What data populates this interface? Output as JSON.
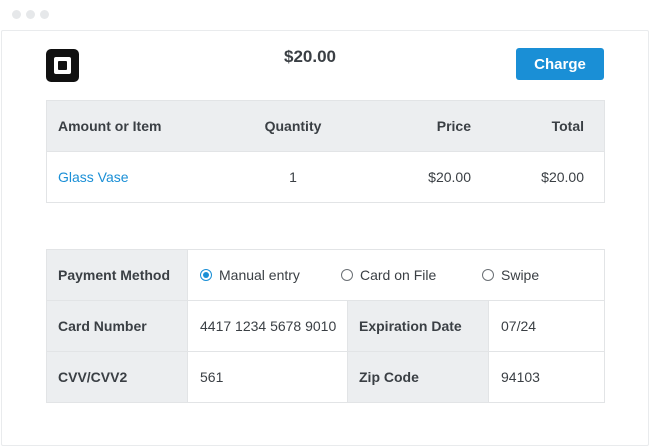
{
  "header": {
    "total": "$20.00",
    "charge_label": "Charge",
    "logo_icon": "square-logo-icon"
  },
  "items_table": {
    "columns": [
      "Amount or Item",
      "Quantity",
      "Price",
      "Total"
    ],
    "rows": [
      {
        "item": "Glass Vase",
        "quantity": "1",
        "price": "$20.00",
        "total": "$20.00"
      }
    ]
  },
  "payment": {
    "method_label": "Payment Method",
    "options": [
      "Manual entry",
      "Card on File",
      "Swipe"
    ],
    "selected_option": "Manual entry",
    "card_number_label": "Card Number",
    "card_number": "4417 1234 5678 9010",
    "expiration_label": "Expiration Date",
    "expiration": "07/24",
    "cvv_label": "CVV/CVV2",
    "cvv": "561",
    "zip_label": "Zip Code",
    "zip": "94103"
  },
  "colors": {
    "accent": "#1a8fd6",
    "header_bg": "#eceef0",
    "border": "#e2e4e6",
    "text": "#3a3f44"
  }
}
